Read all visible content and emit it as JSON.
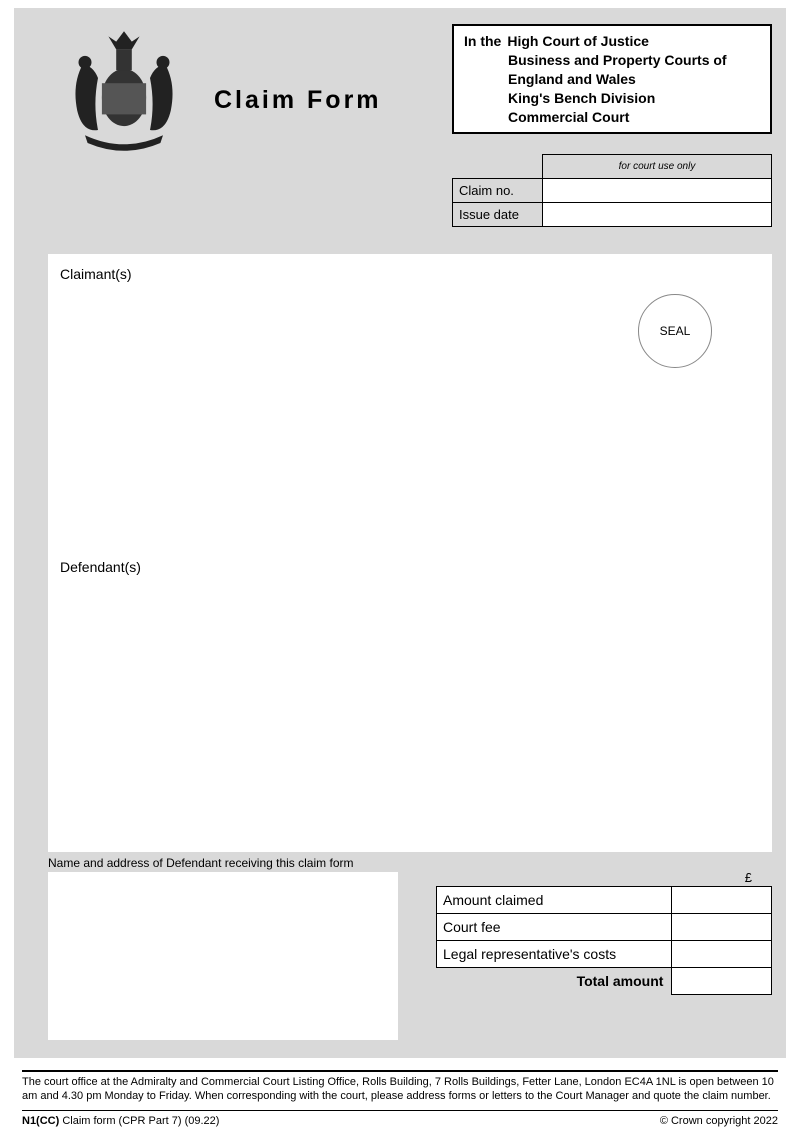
{
  "title": "Claim Form",
  "court_box": {
    "in_the": "In the",
    "line1": "High Court of Justice",
    "line2": "Business and Property Courts of England and Wales",
    "line3": "King's Bench Division",
    "line4": "Commercial Court"
  },
  "meta": {
    "for_court_use": "for court use only",
    "claim_no_label": "Claim no.",
    "claim_no_value": "",
    "issue_date_label": "Issue date",
    "issue_date_value": ""
  },
  "parties": {
    "claimant_label": "Claimant(s)",
    "defendant_label": "Defendant(s)",
    "seal": "SEAL"
  },
  "defendant_receive": {
    "label": "Name and address of Defendant receiving this claim form",
    "value": ""
  },
  "amounts": {
    "currency": "£",
    "amount_claimed_label": "Amount claimed",
    "amount_claimed_value": "",
    "court_fee_label": "Court fee",
    "court_fee_value": "",
    "legal_costs_label": "Legal representative's costs",
    "legal_costs_value": "",
    "total_label": "Total amount",
    "total_value": ""
  },
  "footer": {
    "office_text": "The court office at the Admiralty and Commercial Court Listing Office, Rolls Building, 7 Rolls Buildings, Fetter Lane, London EC4A 1NL is open between 10 am and 4.30 pm Monday to Friday. When corresponding with the court, please address forms or letters to the Court Manager and quote the claim number.",
    "form_code": "N1(CC)",
    "form_desc": " Claim form (CPR Part 7) (09.22)",
    "copyright": "© Crown copyright 2022"
  }
}
